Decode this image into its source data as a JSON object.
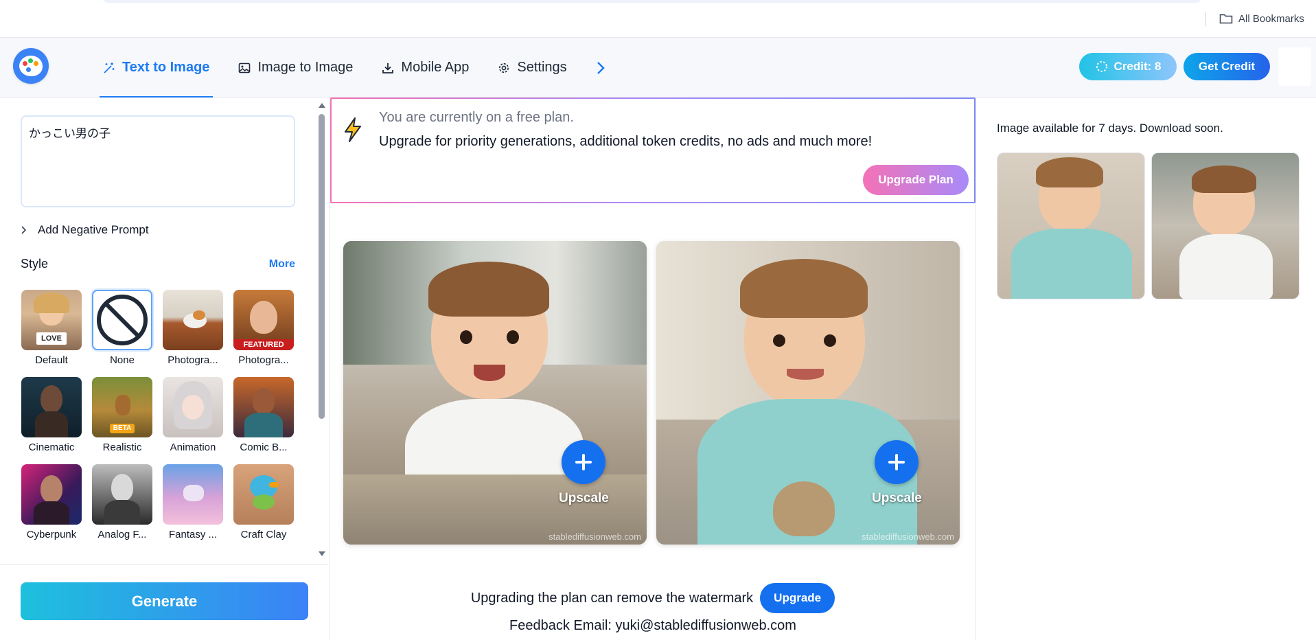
{
  "browser": {
    "bookmarks_label": "All Bookmarks"
  },
  "header": {
    "tabs": [
      {
        "label": "Text to Image",
        "icon": "magic-wand-icon",
        "active": true
      },
      {
        "label": "Image to Image",
        "icon": "image-icon",
        "active": false
      },
      {
        "label": "Mobile App",
        "icon": "download-icon",
        "active": false
      },
      {
        "label": "Settings",
        "icon": "gear-icon",
        "active": false
      }
    ],
    "credit_label": "Credit: 8",
    "get_credit_label": "Get Credit"
  },
  "sidebar": {
    "prompt_value": "かっこい男の子",
    "negative_prompt_label": "Add Negative Prompt",
    "style_title": "Style",
    "style_more": "More",
    "styles": [
      {
        "label": "Default",
        "badge": "LOVE"
      },
      {
        "label": "None",
        "selected": true
      },
      {
        "label": "Photogra..."
      },
      {
        "label": "Photogra...",
        "badge": "FEATURED"
      },
      {
        "label": "Cinematic"
      },
      {
        "label": "Realistic",
        "badge": "BETA"
      },
      {
        "label": "Animation"
      },
      {
        "label": "Comic B..."
      },
      {
        "label": "Cyberpunk"
      },
      {
        "label": "Analog F..."
      },
      {
        "label": "Fantasy ..."
      },
      {
        "label": "Craft Clay"
      }
    ],
    "generate_label": "Generate"
  },
  "main": {
    "banner": {
      "line1": "You are currently on a free plan.",
      "line2": "Upgrade for priority generations, additional token credits, no ads and much more!",
      "button": "Upgrade Plan"
    },
    "results": [
      {
        "upscale_label": "Upscale",
        "watermark": "stablediffusionweb.com"
      },
      {
        "upscale_label": "Upscale",
        "watermark": "stablediffusionweb.com"
      }
    ],
    "watermark_note": "Upgrading the plan can remove the watermark",
    "upgrade_label": "Upgrade",
    "feedback": "Feedback Email: yuki@stablediffusionweb.com"
  },
  "gallery": {
    "availability": "Image available for 7 days. Download soon."
  },
  "colors": {
    "accent": "#1d7af3",
    "upscale": "#1570ef",
    "generate_gradient_start": "#1ec0dd",
    "generate_gradient_end": "#3b82f6"
  }
}
